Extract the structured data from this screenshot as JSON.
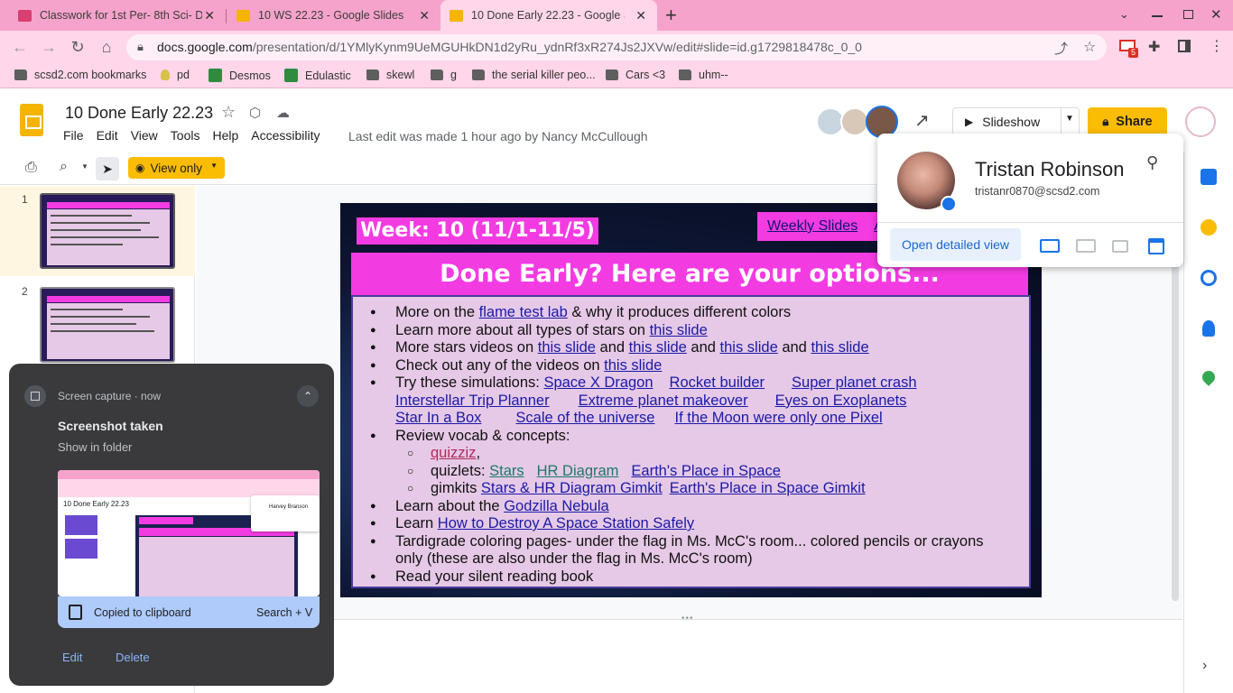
{
  "browser": {
    "tabs": [
      {
        "title": "Classwork for 1st Per- 8th Sci- Da",
        "favicon_color": "#d93f71",
        "active": false
      },
      {
        "title": "10 WS 22.23 - Google Slides",
        "favicon_color": "#f4b400",
        "active": false
      },
      {
        "title": "10 Done Early 22.23 - Google Slid",
        "favicon_color": "#f4b400",
        "active": true
      }
    ],
    "url_host": "docs.google.com",
    "url_path": "/presentation/d/1YMlyKynm9UeMGUHkDN1d2yRu_ydnRf3xR274Js2JXVw/edit#slide=id.g1729818478c_0_0",
    "gmail_badge": "5",
    "bookmarks": [
      {
        "label": "scsd2.com bookmarks",
        "icon": "folder"
      },
      {
        "label": "pd",
        "icon": "bulb"
      },
      {
        "label": "Desmos",
        "icon": "desmos"
      },
      {
        "label": "Edulastic",
        "icon": "edulastic"
      },
      {
        "label": "skewl",
        "icon": "folder"
      },
      {
        "label": "g",
        "icon": "folder"
      },
      {
        "label": "the serial killer peo...",
        "icon": "folder"
      },
      {
        "label": "Cars <3",
        "icon": "folder"
      },
      {
        "label": "uhm--",
        "icon": "folder"
      }
    ]
  },
  "docs": {
    "title": "10 Done Early 22.23",
    "menu": [
      "File",
      "Edit",
      "View",
      "Tools",
      "Help",
      "Accessibility"
    ],
    "last_edit": "Last edit was made 1 hour ago by Nancy McCullough",
    "slideshow_label": "Slideshow",
    "share_label": "Share",
    "view_only_label": "View only"
  },
  "filmstrip": {
    "slides": [
      {
        "number": "1",
        "caption": "Week: 10  (11/1-11/5)"
      },
      {
        "number": "2",
        "caption": "Week: 9  (10/24-10/28)"
      }
    ]
  },
  "slide": {
    "week_label": "Week: 10  (11/1-11/5)",
    "weekly_link": "Weekly Slides",
    "weekly_link_cut": "A",
    "banner": "Done Early?  Here are your options...",
    "items": {
      "i1_a": "More on the ",
      "i1_link": "flame test lab",
      "i1_b": " & why it produces different colors",
      "i2_a": "Learn more about all types of stars on ",
      "i2_link": "this slide",
      "i3_a": "More stars videos on ",
      "i3_l1": "this slide",
      "and": " and ",
      "i3_l2": "this slide",
      "i3_l3": "this slide",
      "i3_l4": "this slide",
      "i4_a": "Check out any of the videos on ",
      "i4_link": "this slide",
      "i5_a": "Try these simulations:  ",
      "sims": [
        "Space X Dragon",
        "Rocket builder",
        "Super planet crash",
        "Interstellar Trip Planner",
        "Extreme planet makeover",
        "Eyes on Exoplanets",
        "Star In a Box",
        "Scale of the universe",
        "If the Moon were only one Pixel"
      ],
      "i6": "Review vocab & concepts:",
      "quizziz": "quizziz",
      "comma": ",",
      "quizlets_label": "quizlets:  ",
      "quizlets": [
        "Stars",
        "HR Diagram",
        "Earth's Place in Space"
      ],
      "gimkits_label": "gimkits ",
      "gimkits": [
        "Stars & HR Diagram Gimkit",
        "Earth's Place in Space Gimkit"
      ],
      "i7_a": "Learn about the ",
      "i7_link": "Godzilla Nebula",
      "i8_a": "Learn ",
      "i8_link": "How to Destroy A Space Station Safely",
      "i9": "Tardigrade coloring pages- under the flag in Ms. McC's room... colored pencils or crayons only (these are also under the flag in Ms. McC's room)",
      "i10": "Read your silent reading book"
    }
  },
  "profile": {
    "name": "Tristan Robinson",
    "email": "tristanr0870@scsd2.com",
    "open_detail": "Open detailed view"
  },
  "notification": {
    "source": "Screen capture  ·  now",
    "title": "Screenshot taken",
    "subtitle": "Show in folder",
    "clipboard": "Copied to clipboard",
    "shortcut": "Search + V",
    "edit": "Edit",
    "delete": "Delete",
    "thumb_title": "10 Done Early 22.23",
    "thumb_user": "Harvey Branson"
  },
  "colors": {
    "tab_strip": "#f6a3cb",
    "toolbar": "#ffd6ea",
    "slide_pink": "#f33be2",
    "slide_lavender": "#e6c9e6",
    "accent_yellow": "#fbbc04"
  }
}
